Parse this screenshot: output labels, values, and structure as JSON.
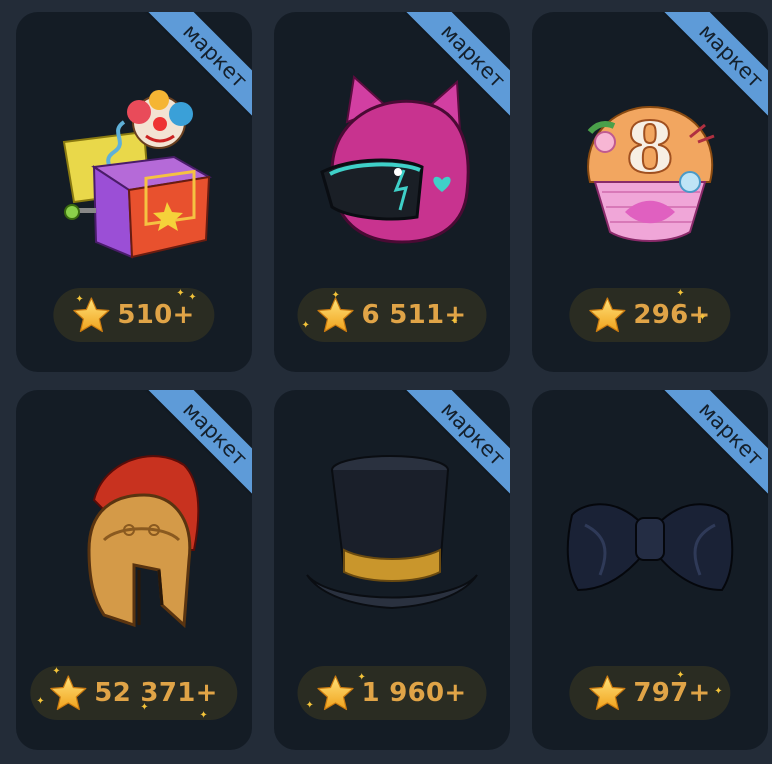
{
  "colors": {
    "background": "#232c38",
    "card": "#141c25",
    "ribbon": "#5e9bd8",
    "price": "#e0a447",
    "pill": "#2a2c22"
  },
  "items": [
    {
      "ribbon": "маркет",
      "price": "510+",
      "icon": "jack-in-the-box-icon"
    },
    {
      "ribbon": "маркет",
      "price": "6 511+",
      "icon": "pink-cat-helmet-icon"
    },
    {
      "ribbon": "маркет",
      "price": "296+",
      "icon": "cupcake-8-icon"
    },
    {
      "ribbon": "маркет",
      "price": "52 371+",
      "icon": "spartan-helmet-icon"
    },
    {
      "ribbon": "маркет",
      "price": "1 960+",
      "icon": "top-hat-icon"
    },
    {
      "ribbon": "маркет",
      "price": "797+",
      "icon": "bow-tie-icon"
    }
  ],
  "price_icon": "star-icon"
}
